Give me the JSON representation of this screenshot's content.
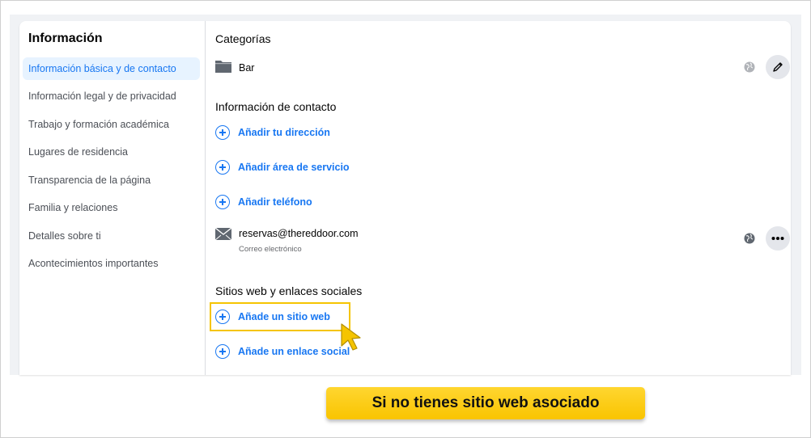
{
  "sidebar": {
    "title": "Información",
    "items": [
      {
        "label": "Información básica y de contacto",
        "active": true
      },
      {
        "label": "Información legal y de privacidad"
      },
      {
        "label": "Trabajo y formación académica"
      },
      {
        "label": "Lugares de residencia"
      },
      {
        "label": "Transparencia de la página"
      },
      {
        "label": "Familia y relaciones"
      },
      {
        "label": "Detalles sobre ti"
      },
      {
        "label": "Acontecimientos importantes"
      }
    ]
  },
  "categories": {
    "title": "Categorías",
    "value": "Bar",
    "icon": "folder-icon"
  },
  "contact": {
    "title": "Información de contacto",
    "add_address": "Añadir tu dirección",
    "add_service_area": "Añadir área de servicio",
    "add_phone": "Añadir teléfono",
    "email": "reservas@thereddoor.com",
    "email_label": "Correo electrónico"
  },
  "websites": {
    "title": "Sitios web y enlaces sociales",
    "add_website": "Añade un sitio web",
    "add_social": "Añade un enlace social"
  },
  "banner": {
    "text": "Si no tienes sitio web asociado"
  },
  "colors": {
    "accent": "#1877f2",
    "highlight": "#f5c400",
    "banner": "#ffd12a"
  }
}
